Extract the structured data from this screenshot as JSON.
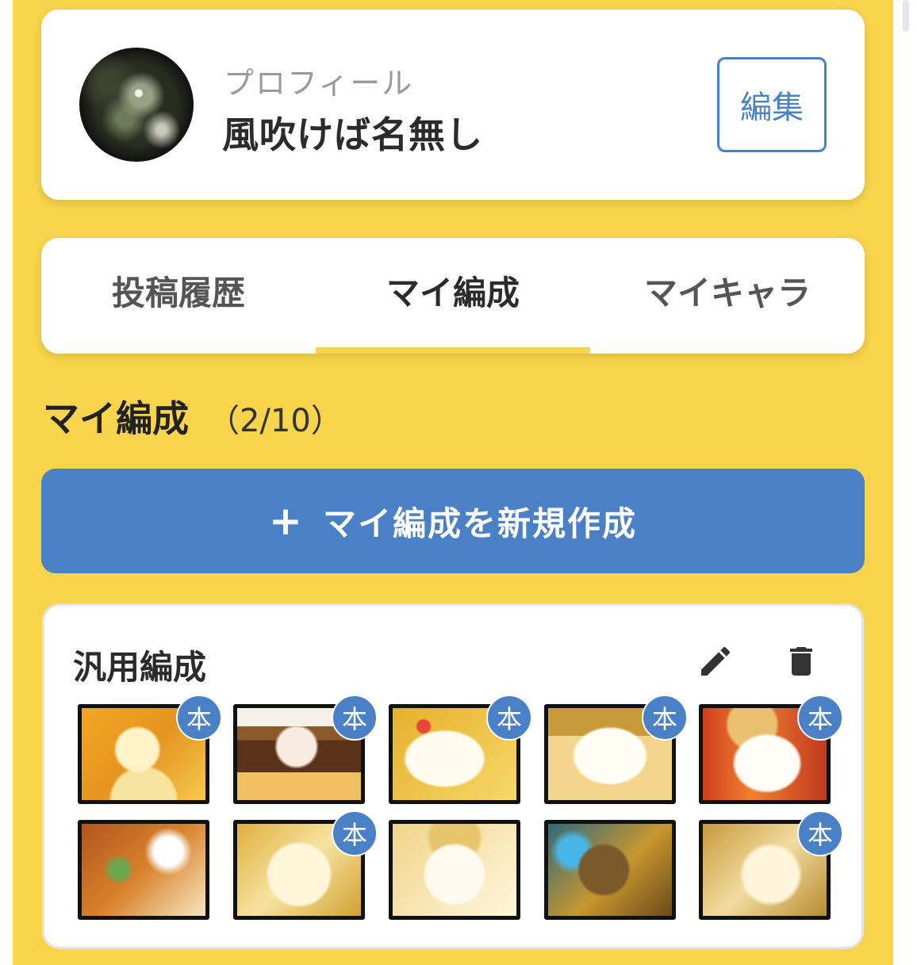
{
  "profile": {
    "caption": "プロフィール",
    "name": "風吹けば名無し",
    "edit_label": "編集"
  },
  "tabs": [
    {
      "label": "投稿履歴",
      "active": false
    },
    {
      "label": "マイ編成",
      "active": true
    },
    {
      "label": "マイキャラ",
      "active": false
    }
  ],
  "section": {
    "title": "マイ編成",
    "count": "（2/10）"
  },
  "create_button": {
    "icon": "+",
    "label": "マイ編成を新規作成"
  },
  "formation": {
    "name": "汎用編成",
    "actions": [
      "pencil-icon",
      "trash-icon"
    ],
    "slots": [
      {
        "badge": "本"
      },
      {
        "badge": "本"
      },
      {
        "badge": "本"
      },
      {
        "badge": "本"
      },
      {
        "badge": "本"
      },
      {
        "badge": ""
      },
      {
        "badge": "本"
      },
      {
        "badge": ""
      },
      {
        "badge": ""
      },
      {
        "badge": "本"
      }
    ]
  },
  "colors": {
    "background": "#f7d44c",
    "accent": "#4a80c6",
    "card": "#ffffff"
  }
}
